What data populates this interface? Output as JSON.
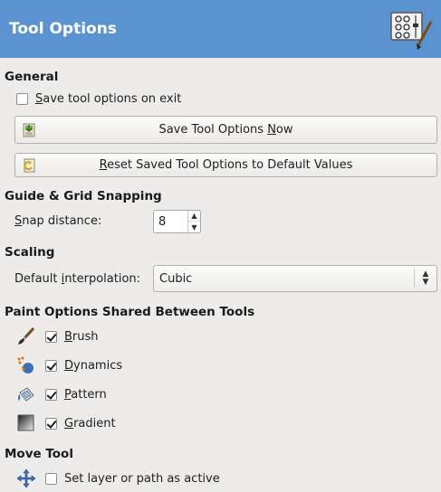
{
  "header": {
    "title": "Tool Options",
    "icon": "tool-options-icon"
  },
  "general": {
    "title": "General",
    "save_on_exit": {
      "mnemonic": "S",
      "rest": "ave tool options on exit",
      "checked": false
    },
    "save_now": {
      "pre": "Save Tool Options ",
      "mnemonic": "N",
      "post": "ow"
    },
    "reset": {
      "mnemonic": "R",
      "rest": "eset Saved Tool Options to Default Values"
    }
  },
  "snapping": {
    "title": "Guide & Grid Snapping",
    "snap_label": {
      "mnemonic": "S",
      "rest": "nap distance:"
    },
    "snap_value": "8"
  },
  "scaling": {
    "title": "Scaling",
    "interp_label": {
      "pre": "Default ",
      "mnemonic": "i",
      "post": "nterpolation:"
    },
    "interp_value": "Cubic"
  },
  "paint": {
    "title": "Paint Options Shared Between Tools",
    "items": [
      {
        "mnemonic": "B",
        "rest": "rush",
        "checked": true,
        "icon": "brush-icon"
      },
      {
        "mnemonic": "D",
        "rest": "ynamics",
        "checked": true,
        "icon": "dynamics-icon"
      },
      {
        "mnemonic": "P",
        "rest": "attern",
        "checked": true,
        "icon": "pattern-icon"
      },
      {
        "mnemonic": "G",
        "rest": "radient",
        "checked": true,
        "icon": "gradient-icon"
      }
    ]
  },
  "move": {
    "title": "Move Tool",
    "set_active": {
      "label": "Set layer or path as active",
      "checked": false,
      "icon": "move-icon"
    }
  },
  "colors": {
    "header_bg": "#5a93cf",
    "panel_bg": "#edeceb"
  }
}
